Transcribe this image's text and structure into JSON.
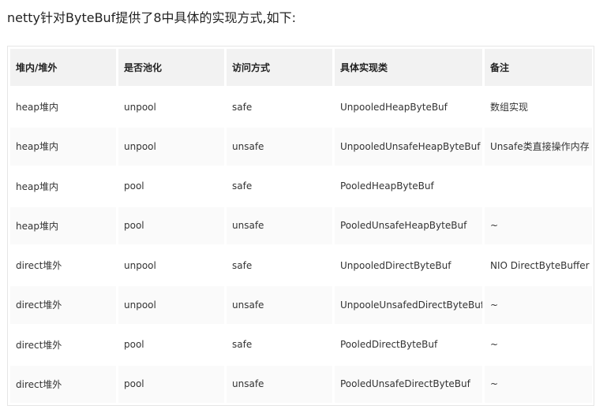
{
  "intro_text": "netty针对ByteBuf提供了8中具体的实现方式,如下:",
  "table": {
    "headers": [
      "堆内/堆外",
      "是否池化",
      "访问方式",
      "具体实现类",
      "备注"
    ],
    "rows": [
      [
        "heap堆内",
        "unpool",
        "safe",
        "UnpooledHeapByteBuf",
        "数组实现"
      ],
      [
        "heap堆内",
        "unpool",
        "unsafe",
        "UnpooledUnsafeHeapByteBuf",
        "Unsafe类直接操作内存"
      ],
      [
        "heap堆内",
        "pool",
        "safe",
        "PooledHeapByteBuf",
        ""
      ],
      [
        "heap堆内",
        "pool",
        "unsafe",
        "PooledUnsafeHeapByteBuf",
        "~"
      ],
      [
        "direct堆外",
        "unpool",
        "safe",
        "UnpooledDirectByteBuf",
        "NIO DirectByteBuffer"
      ],
      [
        "direct堆外",
        "unpool",
        "unsafe",
        "UnpooleUnsafedDirectByteBuf",
        "~"
      ],
      [
        "direct堆外",
        "pool",
        "safe",
        "PooledDirectByteBuf",
        "~"
      ],
      [
        "direct堆外",
        "pool",
        "unsafe",
        "PooledUnsafeDirectByteBuf",
        "~"
      ]
    ]
  }
}
